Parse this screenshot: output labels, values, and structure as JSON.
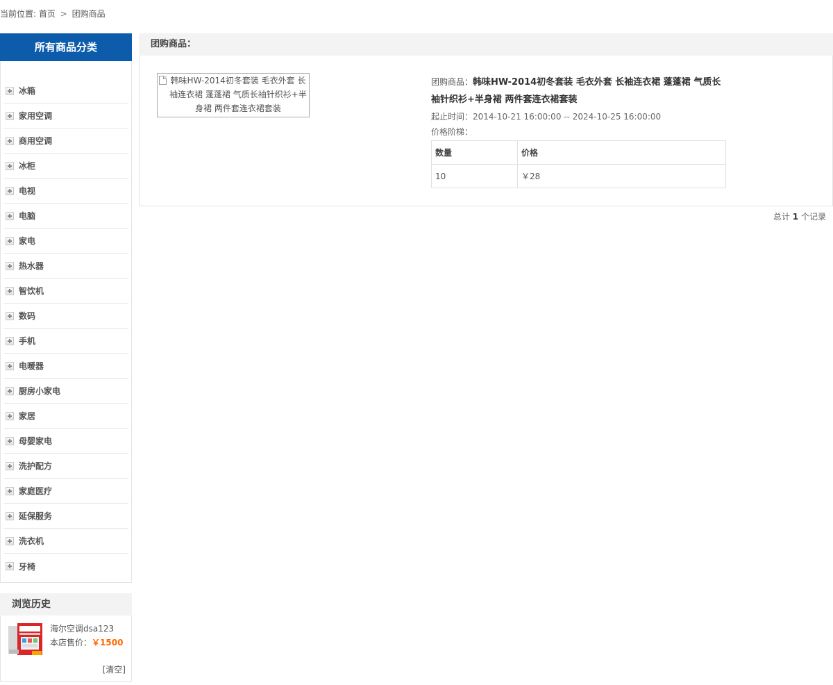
{
  "breadcrumb": {
    "prefix": "当前位置:",
    "home": "首页",
    "sep": ">",
    "current": "团购商品"
  },
  "sidebar": {
    "title": "所有商品分类",
    "categories": [
      "冰箱",
      "家用空调",
      "商用空调",
      "冰柜",
      "电视",
      "电脑",
      "家电",
      "热水器",
      "智饮机",
      "数码",
      "手机",
      "电暖器",
      "厨房小家电",
      "家居",
      "母婴家电",
      "洗护配方",
      "家庭医疗",
      "延保服务",
      "洗衣机",
      "牙椅"
    ]
  },
  "history": {
    "title": "浏览历史",
    "item_name": "海尔空调dsa123",
    "price_label": "本店售价：",
    "price": "￥1500",
    "clear": "[清空]"
  },
  "main": {
    "header": "团购商品：",
    "image_alt": "韩味HW-2014初冬套装 毛衣外套 长袖连衣裙 蓬蓬裙 气质长袖针织衫+半身裙 两件套连衣裙套装",
    "product_prefix": "团购商品：",
    "product_name": "韩味HW-2014初冬套装 毛衣外套 长袖连衣裙 蓬蓬裙 气质长袖针织衫+半身裙 两件套连衣裙套装",
    "time": "起止时间：2014-10-21 16:00:00 -- 2024-10-25 16:00:00",
    "tier_label": "价格阶梯：",
    "tier_headers": [
      "数量",
      "价格"
    ],
    "tier_rows": [
      [
        "10",
        "￥28"
      ]
    ]
  },
  "pager": {
    "prefix": "总计",
    "count": "1",
    "suffix": "个记录"
  },
  "colors": {
    "brand_blue": "#0d5cab",
    "price_orange": "#ff6a00"
  }
}
